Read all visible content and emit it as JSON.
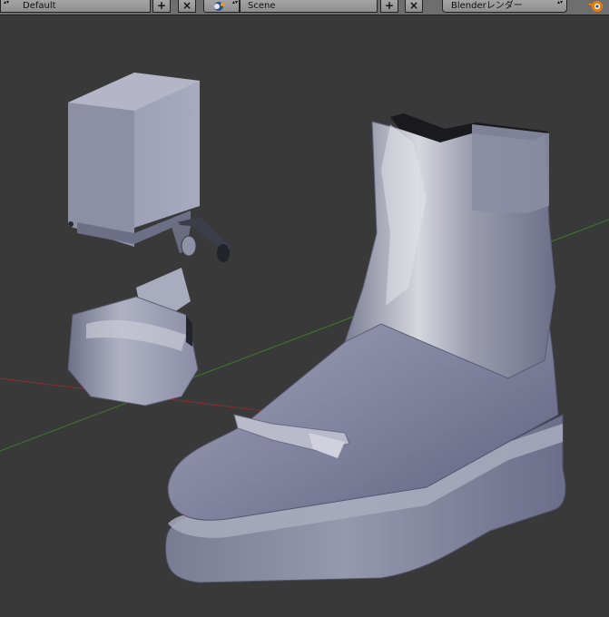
{
  "header": {
    "layout_name": "Default",
    "scene_name": "Scene",
    "add_symbol": "+",
    "close_symbol": "×",
    "render_engine": "Blenderレンダー",
    "dropdown_arrows": "▴▾",
    "icons": {
      "screen_layout": "screen-layout-icon",
      "scene": "scene-icon",
      "blender": "blender-logo-icon"
    }
  },
  "viewport": {
    "background": "#393939",
    "grid_x_axis_color": "#8a2e2e",
    "grid_y_axis_color": "#3d7a28",
    "objects": [
      "boot",
      "buckle",
      "toe-cap"
    ]
  }
}
